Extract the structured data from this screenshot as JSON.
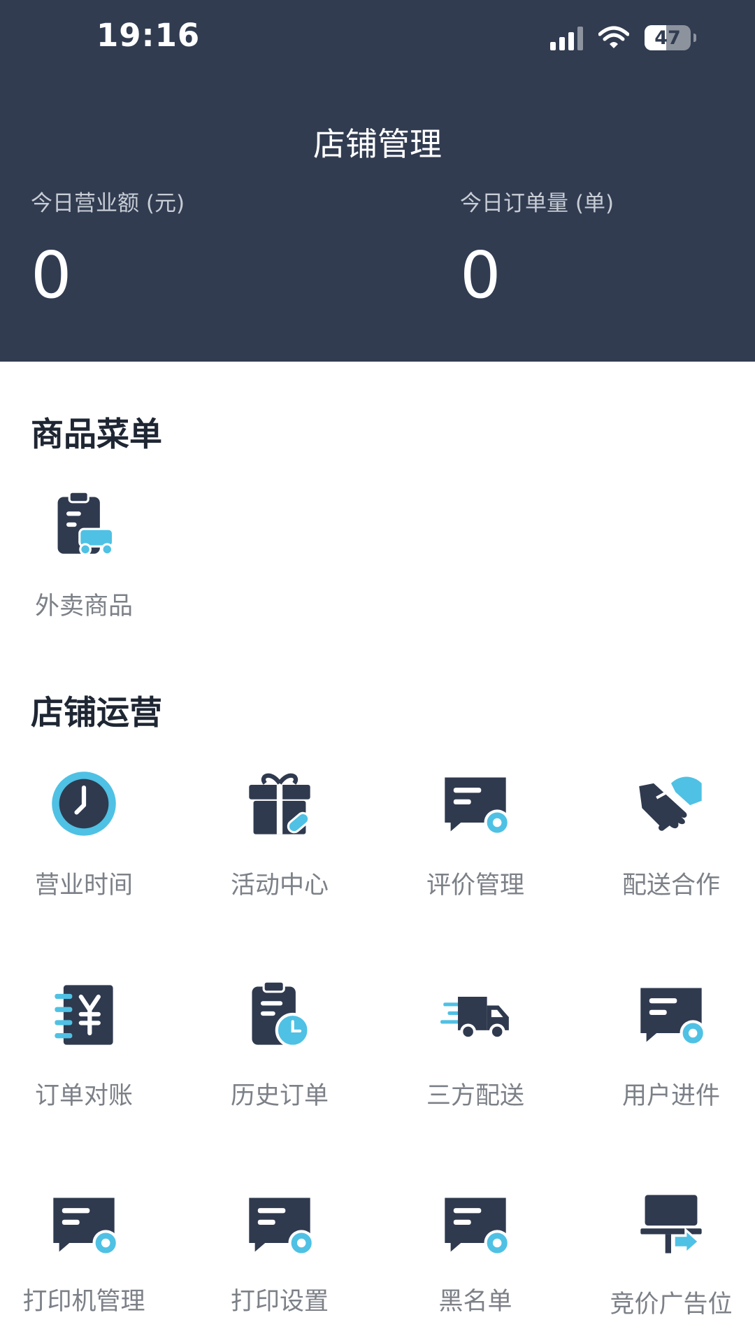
{
  "status_bar": {
    "time": "19:16",
    "battery": "47",
    "battery_level": 0.47
  },
  "header": {
    "title": "店铺管理",
    "stats": [
      {
        "label": "今日营业额 (元)",
        "value": "0"
      },
      {
        "label": "今日订单量 (单)",
        "value": "0"
      }
    ]
  },
  "sections": [
    {
      "title": "商品菜单",
      "items": [
        {
          "label": "外卖商品",
          "icon": "takeout-goods-icon"
        }
      ]
    },
    {
      "title": "店铺运营",
      "items": [
        {
          "label": "营业时间",
          "icon": "clock-icon"
        },
        {
          "label": "活动中心",
          "icon": "gift-icon"
        },
        {
          "label": "评价管理",
          "icon": "review-settings-icon"
        },
        {
          "label": "配送合作",
          "icon": "handshake-icon"
        },
        {
          "label": "订单对账",
          "icon": "yen-ledger-icon"
        },
        {
          "label": "历史订单",
          "icon": "clipboard-clock-icon"
        },
        {
          "label": "三方配送",
          "icon": "delivery-truck-icon"
        },
        {
          "label": "用户进件",
          "icon": "user-application-icon"
        },
        {
          "label": "打印机管理",
          "icon": "printer-settings-icon"
        },
        {
          "label": "打印设置",
          "icon": "print-settings-icon"
        },
        {
          "label": "黑名单",
          "icon": "blacklist-icon"
        },
        {
          "label": "竞价广告位",
          "icon": "ad-slot-icon"
        }
      ]
    }
  ],
  "colors": {
    "header_bg": "#313c51",
    "icon_dark": "#2f3a4f",
    "icon_accent": "#4fc1e4",
    "label_gray": "#7c8087"
  }
}
